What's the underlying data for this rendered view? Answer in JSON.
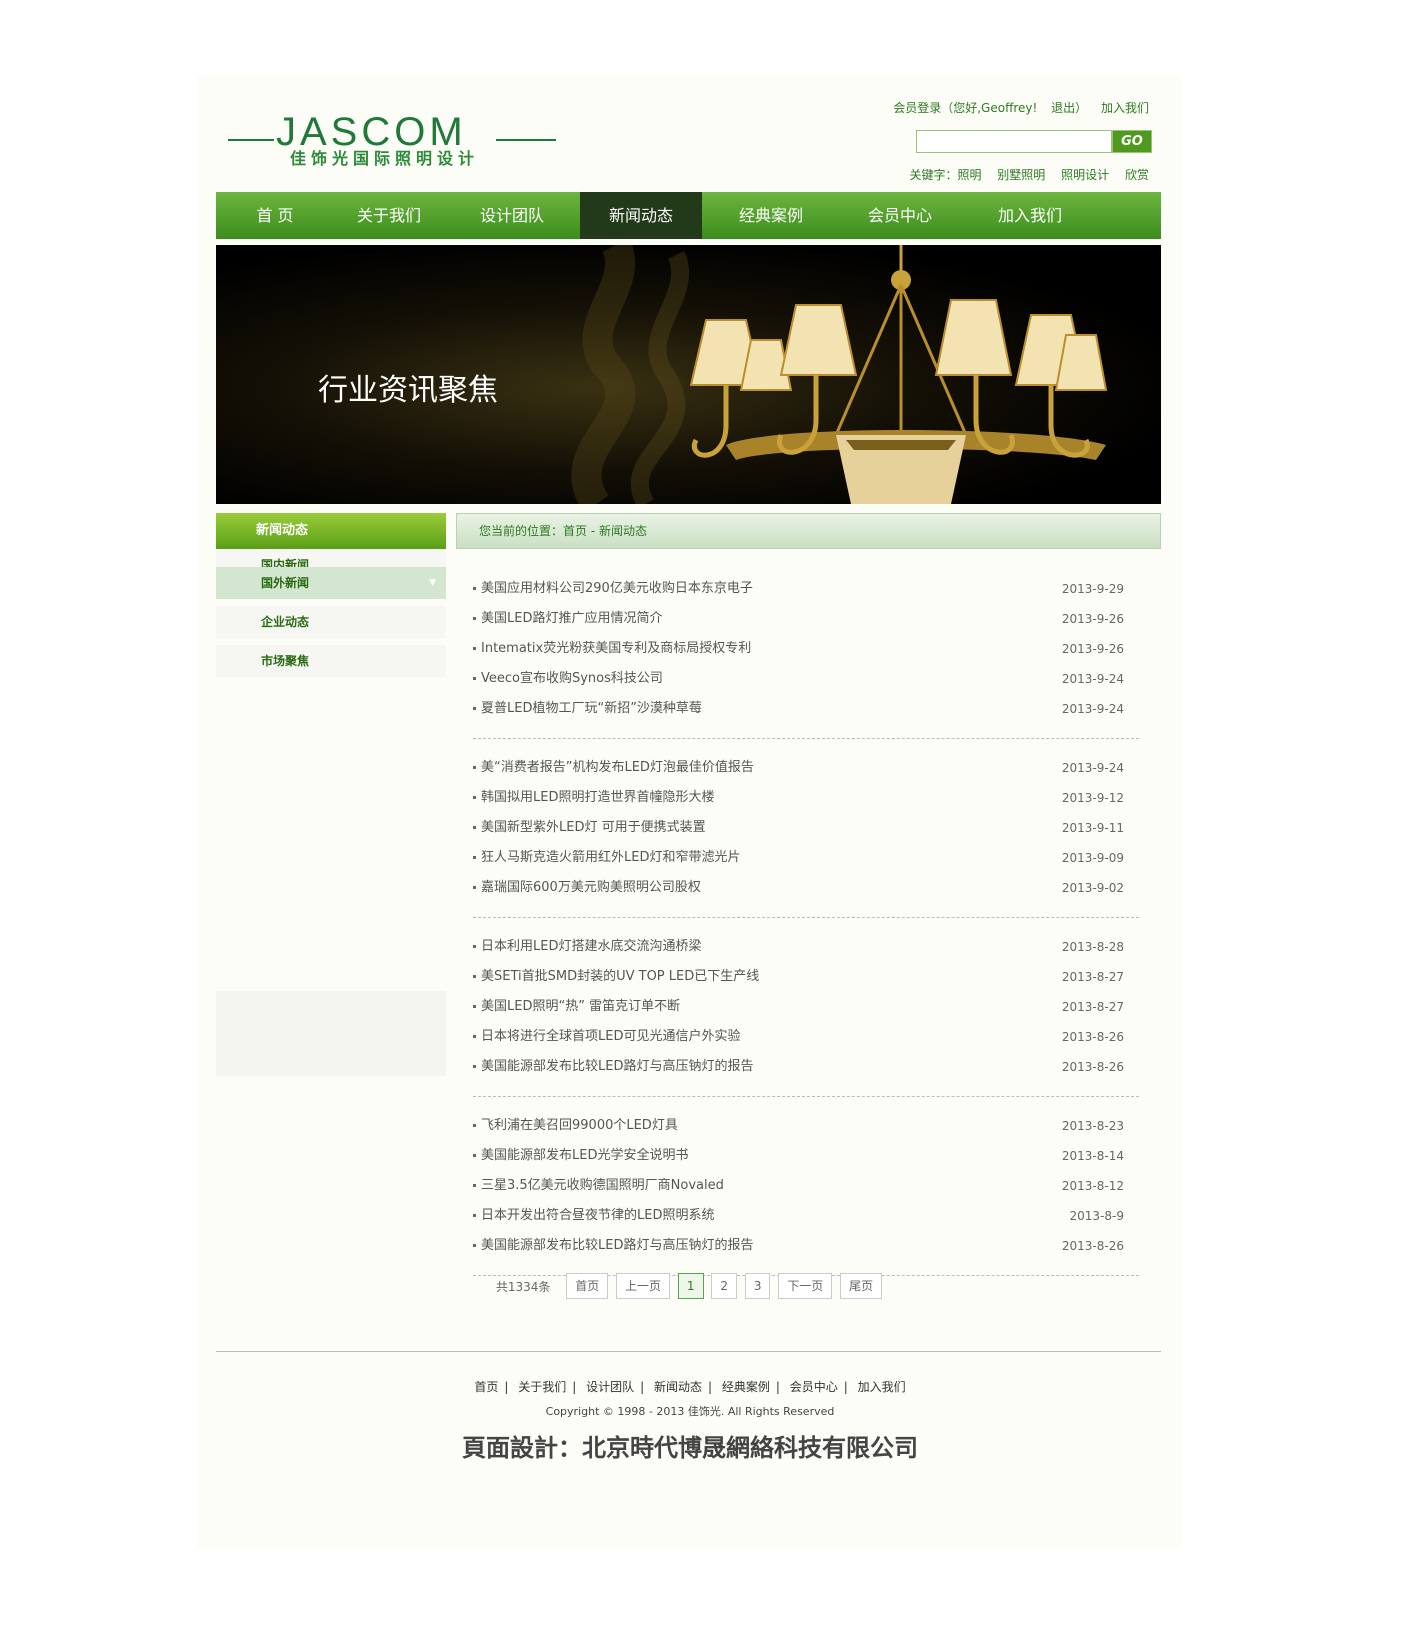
{
  "brand": {
    "name": "JASCOM",
    "subtitle": "佳饰光国际照明设计"
  },
  "toplinks": [
    "会员登录（您好,Geoffrey!",
    "退出）",
    "加入我们"
  ],
  "search": {
    "placeholder": "",
    "button": "GO"
  },
  "keywords": {
    "label": "关键字：照明",
    "items": [
      "别墅照明",
      "照明设计",
      "欣赏"
    ]
  },
  "nav": [
    "首 页",
    "关于我们",
    "设计团队",
    "新闻动态",
    "经典案例",
    "会员中心",
    "加入我们"
  ],
  "nav_active": 3,
  "banner": {
    "title": "行业资讯聚焦"
  },
  "sidebar": {
    "title": "新闻动态",
    "items": [
      "国内新闻",
      "国外新闻",
      "企业动态",
      "市场聚焦"
    ],
    "active": 1
  },
  "breadcrumb": "您当前的位置：首页 - 新闻动态",
  "news_groups": [
    [
      {
        "title": "美国应用材料公司290亿美元收购日本东京电子",
        "date": "2013-9-29"
      },
      {
        "title": "美国LED路灯推广应用情况简介",
        "date": "2013-9-26"
      },
      {
        "title": "Intematix荧光粉获美国专利及商标局授权专利",
        "date": "2013-9-26"
      },
      {
        "title": "Veeco宣布收购Synos科技公司",
        "date": "2013-9-24"
      },
      {
        "title": "夏普LED植物工厂玩“新招”沙漠种草莓",
        "date": "2013-9-24"
      }
    ],
    [
      {
        "title": "美“消费者报告”机构发布LED灯泡最佳价值报告",
        "date": "2013-9-24"
      },
      {
        "title": "韩国拟用LED照明打造世界首幢隐形大楼",
        "date": "2013-9-12"
      },
      {
        "title": "美国新型紫外LED灯 可用于便携式装置",
        "date": "2013-9-11"
      },
      {
        "title": "狂人马斯克造火箭用红外LED灯和窄带滤光片",
        "date": "2013-9-09"
      },
      {
        "title": "嘉瑞国际600万美元购美照明公司股权",
        "date": "2013-9-02"
      }
    ],
    [
      {
        "title": "日本利用LED灯搭建水底交流沟通桥梁",
        "date": "2013-8-28"
      },
      {
        "title": "美SETi首批SMD封装的UV TOP LED已下生产线",
        "date": "2013-8-27"
      },
      {
        "title": "美国LED照明“热” 雷笛克订单不断",
        "date": "2013-8-27"
      },
      {
        "title": "日本将进行全球首项LED可见光通信户外实验",
        "date": "2013-8-26"
      },
      {
        "title": "美国能源部发布比较LED路灯与高压钠灯的报告",
        "date": "2013-8-26"
      }
    ],
    [
      {
        "title": "飞利浦在美召回99000个LED灯具",
        "date": "2013-8-23"
      },
      {
        "title": "美国能源部发布LED光学安全说明书",
        "date": "2013-8-14"
      },
      {
        "title": "三星3.5亿美元收购德国照明厂商Novaled",
        "date": "2013-8-12"
      },
      {
        "title": "日本开发出符合昼夜节律的LED照明系统",
        "date": "2013-8-9"
      },
      {
        "title": "美国能源部发布比较LED路灯与高压钠灯的报告",
        "date": "2013-8-26"
      }
    ]
  ],
  "pager": {
    "total": "共1334条",
    "first": "首页",
    "prev": "上一页",
    "pages": [
      "1",
      "2",
      "3"
    ],
    "current": "1",
    "next": "下一页",
    "last": "尾页"
  },
  "footer": {
    "links": [
      "首页",
      "关于我们",
      "设计团队",
      "新闻动态",
      "经典案例",
      "会员中心",
      "加入我们"
    ],
    "copyright": "Copyright © 1998 - 2013 佳饰光. All Rights Reserved",
    "credit": "頁面設計：北京時代博晟網絡科技有限公司"
  },
  "colors": {
    "brand_green": "#1f7a3a",
    "nav_green": "#4e9a1e",
    "nav_active": "#233a1a",
    "sidebar_active": "#d3e6cf"
  }
}
